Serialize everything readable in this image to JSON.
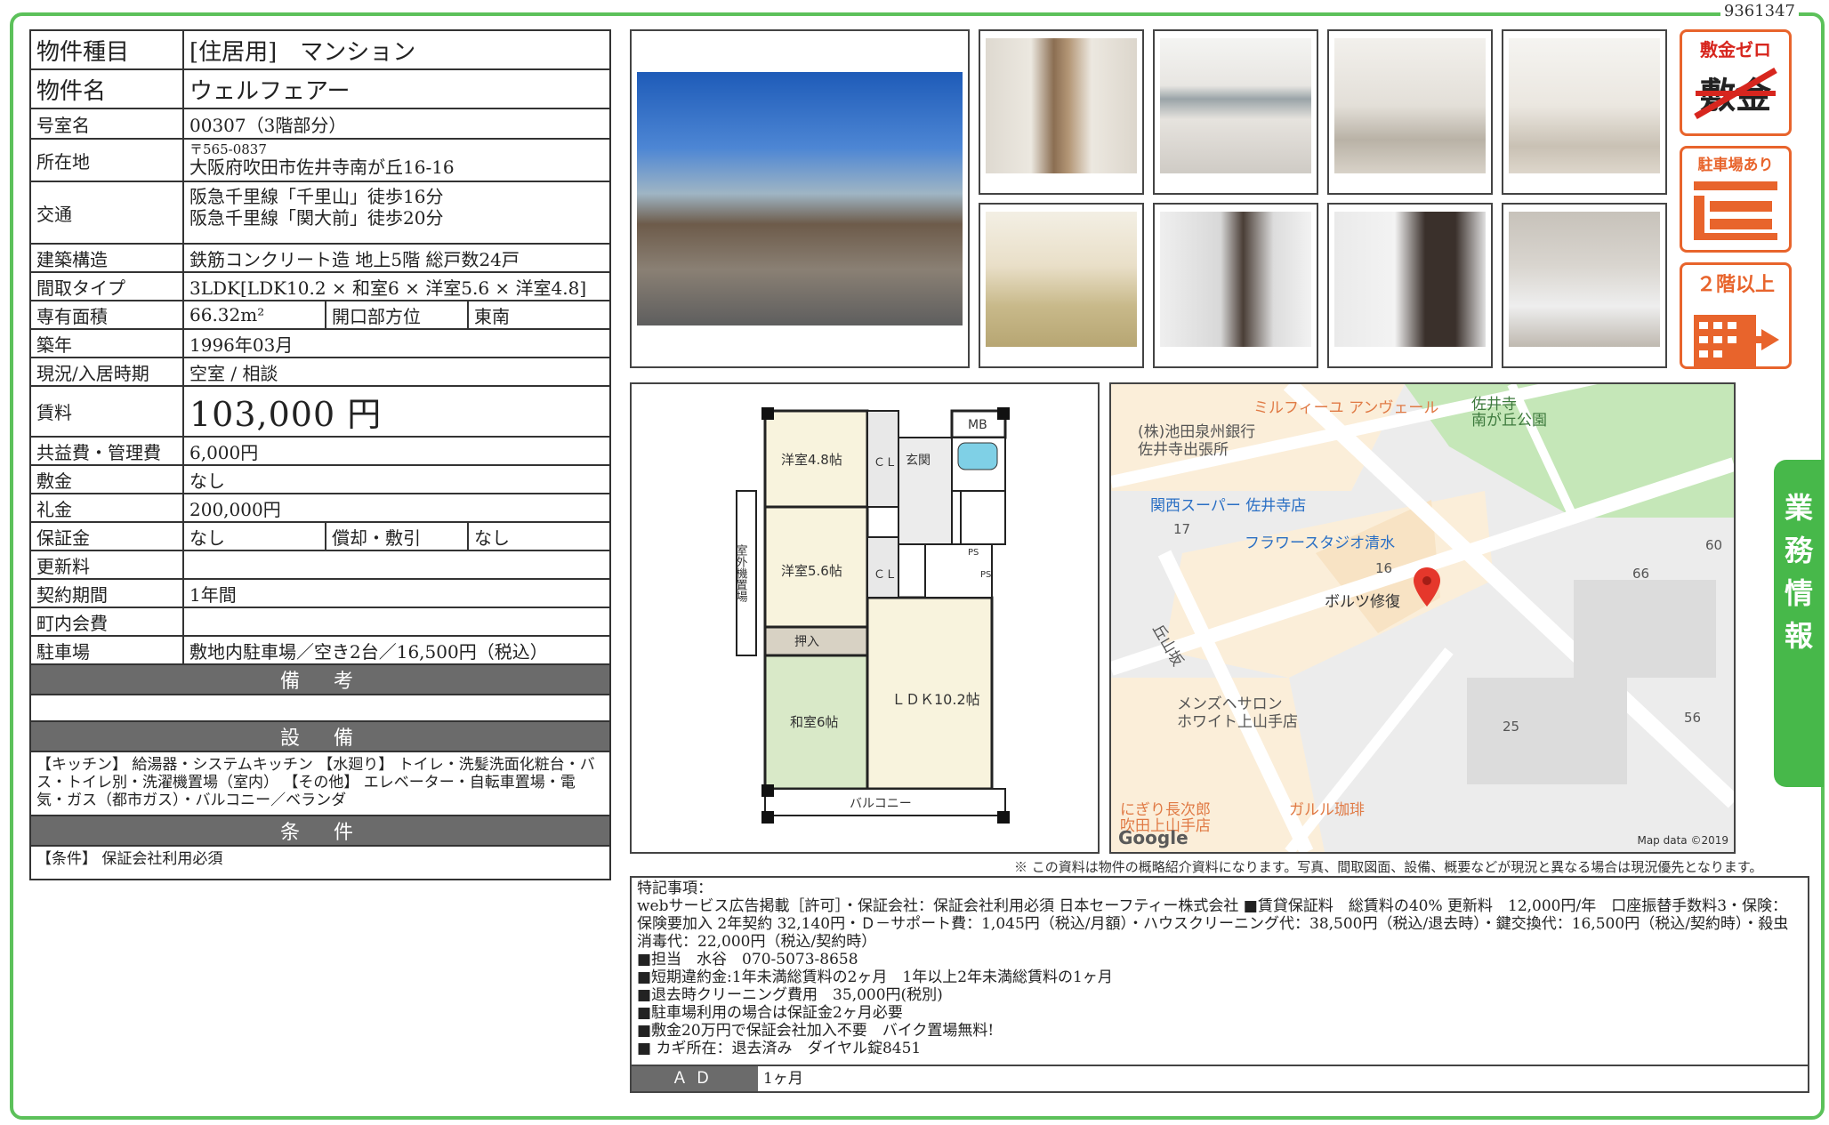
{
  "doc_id": "9361347",
  "spec": {
    "type_label": "物件種目",
    "type_value": "[住居用]　マンション",
    "name_label": "物件名",
    "name_value": "ウェルフェアー",
    "room_label": "号室名",
    "room_value": "00307（3階部分）",
    "address_label": "所在地",
    "postal": "〒565-0837",
    "address": "大阪府吹田市佐井寺南が丘16-16",
    "traffic_label": "交通",
    "traffic_1": "阪急千里線「千里山」徒歩16分",
    "traffic_2": "阪急千里線「関大前」徒歩20分",
    "structure_label": "建築構造",
    "structure_value": "鉄筋コンクリート造 地上5階 総戸数24戸",
    "layout_label": "間取タイプ",
    "layout_value": "3LDK[LDK10.2 × 和室6 × 洋室5.6 × 洋室4.8]",
    "area_label": "専有面積",
    "area_value": "66.32m²",
    "dir_label": "開口部方位",
    "dir_value": "東南",
    "built_label": "築年",
    "built_value": "1996年03月",
    "status_label": "現況/入居時期",
    "status_value": "空室 / 相談",
    "rent_label": "賃料",
    "rent_value": "103,000 円",
    "fee_label": "共益費・管理費",
    "fee_value": "6,000円",
    "deposit_label": "敷金",
    "deposit_value": "なし",
    "key_money_label": "礼金",
    "key_money_value": "200,000円",
    "guarantee_label": "保証金",
    "guarantee_value": "なし",
    "amort_label": "償却・敷引",
    "amort_value": "なし",
    "renewal_label": "更新料",
    "renewal_value": "",
    "contract_label": "契約期間",
    "contract_value": "1年間",
    "assoc_label": "町内会費",
    "assoc_value": "",
    "parking_label": "駐車場",
    "parking_value": "敷地内駐車場／空き2台／16,500円（税込）",
    "remarks_header": "備　考",
    "remarks_value": "",
    "equipment_header": "設　備",
    "equipment_value": "【キッチン】 給湯器・システムキッチン 【水廻り】 トイレ・洗髪洗面化粧台・バス・トイレ別・洗濯機置場（室内） 【その他】 エレベーター・自転車置場・電気・ガス（都市ガス）・バルコニー／ベランダ",
    "conditions_header": "条　件",
    "conditions_value": "【条件】 保証会社利用必須"
  },
  "badges": {
    "zero": "敷金ゼロ",
    "zero_sub": "敷金",
    "parking": "駐車場あり",
    "floor": "２階以上"
  },
  "floorplan": {
    "mb": "MB",
    "w48": "洋室4.8帖",
    "w56": "洋室5.6帖",
    "cl1": "ＣＬ",
    "cl2": "ＣＬ",
    "entrance": "玄関",
    "outdoor": "室外機置場",
    "oshiire": "押入",
    "washitsu": "和室6帖",
    "ldk": "ＬＤＫ10.2帖",
    "balcony": "バルコニー",
    "ps1": "PS",
    "ps2": "PS"
  },
  "map": {
    "poi_1": "ミルフィーユ アンヴェール",
    "park": "佐井寺\n南が丘公園",
    "bank": "(株)池田泉州銀行\n佐井寺出張所",
    "super": "関西スーパー 佐井寺店",
    "n17": "17",
    "flower": "フラワースタジオ清水",
    "n16": "16",
    "repair": "ボルツ修復",
    "n60": "60",
    "n66": "66",
    "slope": "丘山坂",
    "salon": "メンズヘサロン\nホワイト上山手店",
    "n25": "25",
    "n56": "56",
    "nigiri": "にぎり長次郎\n吹田上山手店",
    "cafe": "ガルル珈琲",
    "google": "Google",
    "mapdata": "Map data ©2019"
  },
  "caution": "※ この資料は物件の概略紹介資料になります。写真、間取図面、設備、概要などが現況と異なる場合は現況優先となります。",
  "notes": {
    "title": "特記事項：",
    "line_1": "webサービス広告掲載［許可］・保証会社：保証会社利用必須 日本セーフティー株式会社 ■賃貸保証料　総賃料の40% 更新料　12,000円/年　口座振替手数料3・保険：保険要加入 2年契約 32,140円・Ｄ－サポート費：1,045円（税込/月額）・ハウスクリーニング代：38,500円（税込/退去時）・鍵交換代：16,500円（税込/契約時）・殺虫消毒代：22,000円（税込/契約時）",
    "line_2": "■担当　水谷　070-5073-8658",
    "line_3": "■短期違約金:1年未満総賃料の2ヶ月　1年以上2年未満総賃料の1ヶ月",
    "line_4": "■退去時クリーニング費用　35,000円(税別)",
    "line_5": "■駐車場利用の場合は保証金2ヶ月必要",
    "line_6": "■敷金20万円で保証会社加入不要　バイク置場無料!",
    "line_7": "■ カギ所在：退去済み　ダイヤル錠8451",
    "ad_label": "ＡＤ",
    "ad_value": "1ヶ月"
  },
  "side_tab": [
    "業",
    "務",
    "情",
    "報"
  ]
}
